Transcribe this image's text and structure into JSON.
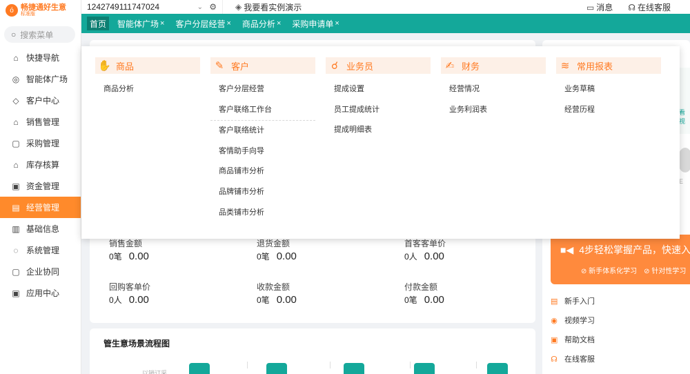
{
  "app": {
    "name": "畅捷通好生意",
    "version": "标准版",
    "search_placeholder": "搜索菜单"
  },
  "sidebar": {
    "items": [
      {
        "label": "快捷导航",
        "icon": "home-icon",
        "glyph": "⌂"
      },
      {
        "label": "智能体广场",
        "icon": "ai-icon",
        "glyph": "◎"
      },
      {
        "label": "客户中心",
        "icon": "diamond-icon",
        "glyph": "◇"
      },
      {
        "label": "销售管理",
        "icon": "sales-icon",
        "glyph": "⌂"
      },
      {
        "label": "采购管理",
        "icon": "bag-icon",
        "glyph": "▢"
      },
      {
        "label": "库存核算",
        "icon": "warehouse-icon",
        "glyph": "⌂"
      },
      {
        "label": "资金管理",
        "icon": "money-icon",
        "glyph": "▣"
      },
      {
        "label": "经营管理",
        "icon": "clipboard-icon",
        "glyph": "▤"
      },
      {
        "label": "基础信息",
        "icon": "info-card-icon",
        "glyph": "▥"
      },
      {
        "label": "系统管理",
        "icon": "settings-circle-icon",
        "glyph": "◌"
      },
      {
        "label": "企业协同",
        "icon": "collab-icon",
        "glyph": "▢"
      },
      {
        "label": "应用中心",
        "icon": "apps-icon",
        "glyph": "▣"
      }
    ],
    "active_index": 7
  },
  "topbar": {
    "account_id": "1242749111747024",
    "demo_label": "我要看实例演示",
    "messages_label": "消息",
    "support_label": "在线客服"
  },
  "tabs": [
    {
      "label": "首页",
      "closable": false
    },
    {
      "label": "智能体广场",
      "closable": true
    },
    {
      "label": "客户分层经营",
      "closable": true
    },
    {
      "label": "商品分析",
      "closable": true
    },
    {
      "label": "采购申请单",
      "closable": true
    }
  ],
  "mega_menu": {
    "columns": [
      {
        "title": "商品",
        "icon": "tag-hand-icon",
        "glyph": "✋",
        "items": [
          "商品分析"
        ]
      },
      {
        "title": "客户",
        "icon": "customer-icon",
        "glyph": "✎",
        "items": [
          "客户分层经营",
          "客户联络工作台",
          "客户联络统计",
          "客情助手向导",
          "商品铺市分析",
          "品牌铺市分析",
          "品类铺市分析"
        ]
      },
      {
        "title": "业务员",
        "icon": "salesman-icon",
        "glyph": "☌",
        "items": [
          "提成设置",
          "员工提成统计",
          "提成明细表"
        ]
      },
      {
        "title": "财务",
        "icon": "finance-icon",
        "glyph": "✍",
        "items": [
          "经营情况",
          "业务利润表"
        ]
      },
      {
        "title": "常用报表",
        "icon": "report-icon",
        "glyph": "≋",
        "items": [
          "业务草稿",
          "经营历程"
        ]
      }
    ]
  },
  "stats": [
    {
      "label": "销售金额",
      "count": "0笔",
      "amount": "0.00"
    },
    {
      "label": "退货金额",
      "count": "0笔",
      "amount": "0.00"
    },
    {
      "label": "首客客单价",
      "count": "0人",
      "amount": "0.00"
    },
    {
      "label": "回购客单价",
      "count": "0人",
      "amount": "0.00"
    },
    {
      "label": "收款金额",
      "count": "0笔",
      "amount": "0.00"
    },
    {
      "label": "付款金额",
      "count": "0笔",
      "amount": "0.00"
    }
  ],
  "flow": {
    "title": "管生意场景流程图",
    "partial_label": "以销订采"
  },
  "right_panel": {
    "edge_text": "看视",
    "edge_text2": "E",
    "promo_title": "4步轻松掌握产品，快速入",
    "promo_tags": [
      "新手体系化学习",
      "针对性学习"
    ],
    "help_links": [
      {
        "label": "新手入门",
        "icon": "book-icon",
        "glyph": "▤"
      },
      {
        "label": "视频学习",
        "icon": "play-icon",
        "glyph": "◉"
      },
      {
        "label": "帮助文档",
        "icon": "doc-icon",
        "glyph": "▣"
      },
      {
        "label": "在线客服",
        "icon": "headset-icon",
        "glyph": "☊"
      }
    ]
  },
  "colors": {
    "brand_orange": "#ff7a22",
    "teal": "#14a89a",
    "active_nav": "#ff8a2b"
  }
}
